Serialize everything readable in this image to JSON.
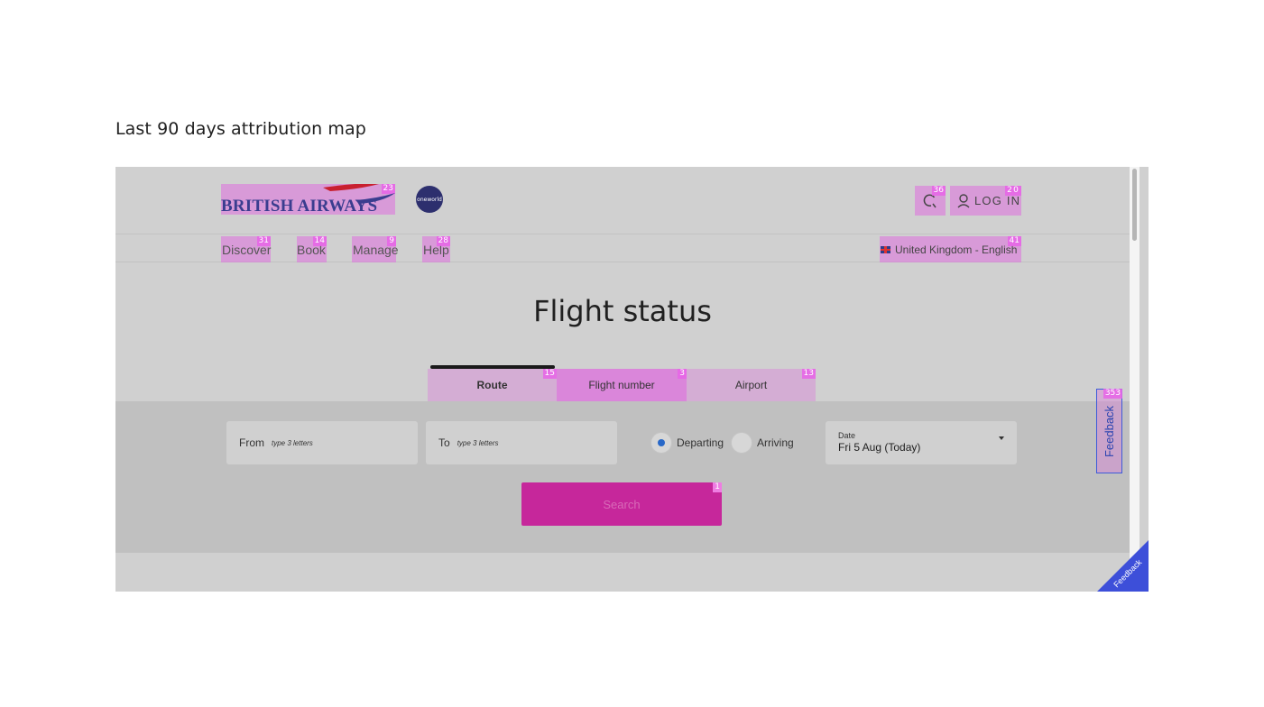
{
  "page": {
    "heading": "Last 90 days attribution map"
  },
  "header": {
    "logo_text": "BRITISH AIRWAYS",
    "logo_badge": "23",
    "oneworld_label": "oneworld",
    "search_badge": "36",
    "login_label": "LOG IN",
    "login_badge": "20"
  },
  "nav": {
    "items": [
      {
        "label": "Discover",
        "badge": "31"
      },
      {
        "label": "Book",
        "badge": "14"
      },
      {
        "label": "Manage",
        "badge": "9"
      },
      {
        "label": "Help",
        "badge": "28"
      }
    ],
    "region_label": "United Kingdom - English",
    "region_badge": "41"
  },
  "main": {
    "title": "Flight status",
    "tabs": [
      {
        "label": "Route",
        "badge": "15"
      },
      {
        "label": "Flight number",
        "badge": "3"
      },
      {
        "label": "Airport",
        "badge": "13"
      }
    ]
  },
  "form": {
    "from_label": "From",
    "from_placeholder": "type 3 letters",
    "to_label": "To",
    "to_placeholder": "type 3 letters",
    "departing_label": "Departing",
    "arriving_label": "Arriving",
    "date_label": "Date",
    "date_value": "Fri 5 Aug (Today)",
    "search_label": "Search",
    "search_badge": "1"
  },
  "feedback": {
    "tab_label": "Feedback",
    "tab_badge": "353",
    "corner_label": "Feedback"
  },
  "colors": {
    "heatmap": "#de6ede",
    "search_button": "#c6279b",
    "feedback_blue": "#3d5bd9",
    "radio_selected": "#2868c8"
  }
}
